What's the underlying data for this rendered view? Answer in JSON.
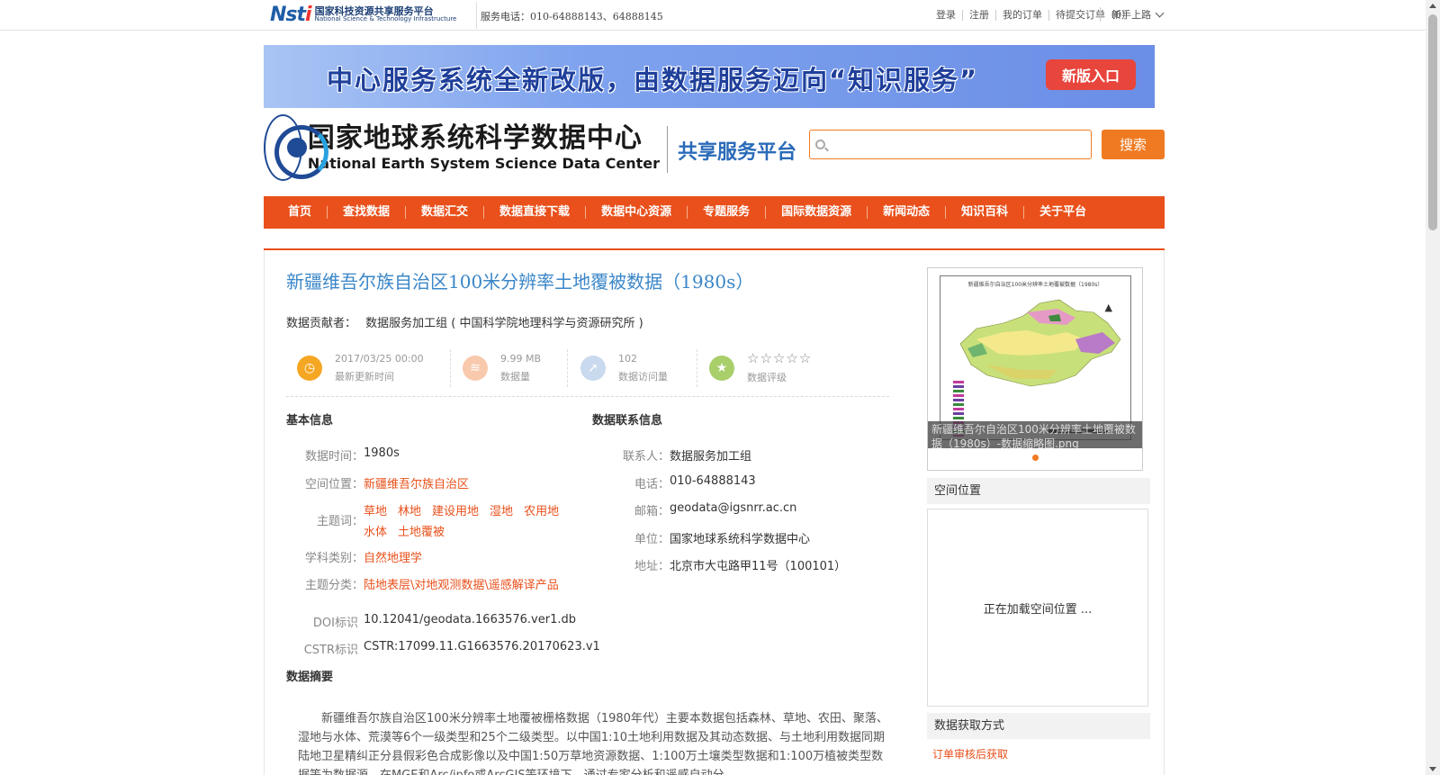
{
  "topbar": {
    "logo_mark": "Nsti",
    "logo_cn": "国家科技资源共享服务平台",
    "logo_en": "National Science & Technology Infrastructure",
    "hotline": "服务电话：010-64888143、64888145",
    "links": [
      "登录",
      "注册",
      "我的订单",
      "待提交订单（0）"
    ],
    "newbie": "新手上路"
  },
  "banner": {
    "text": "中心服务系统全新改版，由数据服务迈向“知识服务”",
    "button": "新版入口"
  },
  "header": {
    "center_cn": "国家地球系统科学数据中心",
    "center_en": "National Earth System Science Data Center",
    "platform": "共享服务平台",
    "search_placeholder": "",
    "search_button": "搜索"
  },
  "nav": [
    "首页",
    "查找数据",
    "数据汇交",
    "数据直接下载",
    "数据中心资源",
    "专题服务",
    "国际数据资源",
    "新闻动态",
    "知识百科",
    "关于平台"
  ],
  "dataset": {
    "title": "新疆维吾尔族自治区100米分辨率土地覆被数据（1980s）",
    "contributor_label": "数据贡献者：",
    "contributor": "数据服务加工组 ( 中国科学院地理科学与资源研究所 )",
    "stats": {
      "updated": "2017/03/25 00:00",
      "updated_label": "最新更新时间",
      "size": "9.99 MB",
      "size_label": "数据量",
      "visits": "102",
      "visits_label": "数据访问量",
      "rating_stars": "☆☆☆☆☆",
      "rating_label": "数据评级"
    },
    "basic_head": "基本信息",
    "basic": {
      "time_label": "数据时间：",
      "time": "1980s",
      "location_label": "空间位置：",
      "location": "新疆维吾尔族自治区",
      "keywords_label": "主题词：",
      "keywords": [
        "草地",
        "林地",
        "建设用地",
        "湿地",
        "农用地",
        "水体",
        "土地覆被"
      ],
      "discipline_label": "学科类别：",
      "discipline": "自然地理学",
      "category_label": "主题分类：",
      "category": "陆地表层\\对地观测数据\\遥感解译产品",
      "doi_label": "DOI标识",
      "doi": "10.12041/geodata.1663576.ver1.db",
      "cstr_label": "CSTR标识",
      "cstr": "CSTR:17099.11.G1663576.20170623.v1"
    },
    "contact_head": "数据联系信息",
    "contact": {
      "person_label": "联系人：",
      "person": "数据服务加工组",
      "phone_label": "电话：",
      "phone": "010-64888143",
      "email_label": "邮箱：",
      "email": "geodata@igsnrr.ac.cn",
      "org_label": "单位：",
      "org": "国家地球系统科学数据中心",
      "address_label": "地址：",
      "address": "北京市大屯路甲11号（100101）"
    },
    "abstract_head": "数据摘要",
    "abstract": "新疆维吾尔族自治区100米分辨率土地覆被栅格数据（1980年代）主要本数据包括森林、草地、农田、聚落、湿地与水体、荒漠等6个一级类型和25个二级类型。以中国1:10土地利用数据及其动态数据、与土地利用数据同期陆地卫星精纠正分县假彩色合成影像以及中国1:50万草地资源数据、1:100万土壤类型数据和1:100万植被类型数据等为数据源，在MGE和Arc/info或ArcGIS等环境下，通过专家分析和遥感自动分"
  },
  "sidebar": {
    "thumb_title": "新疆维吾尔自治区100米分辨率土地覆被数据（1980s）",
    "thumb_caption": "新疆维吾尔自治区100米分辨率土地覆被数据（1980s）-数据缩略图.png",
    "spatial_head": "空间位置",
    "map_loading": "正在加载空间位置 ...",
    "access_head": "数据获取方式",
    "access_link": "订单审核后获取"
  },
  "colors": {
    "accent": "#e9501b",
    "title_blue": "#3a86c8",
    "search_orange": "#f07a21"
  }
}
